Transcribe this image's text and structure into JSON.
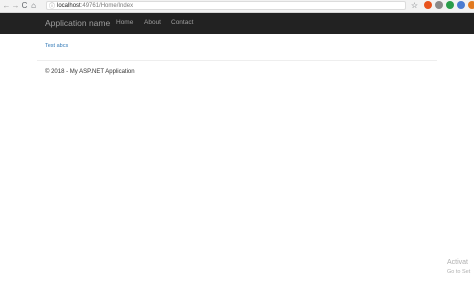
{
  "browser": {
    "back": "←",
    "forward": "→",
    "reload": "C",
    "home": "⌂",
    "url_host": "localhost",
    "url_path": ":49761/Home/Index",
    "star": "☆",
    "extensions": [
      {
        "name": "ext-red",
        "color": "#e8531c"
      },
      {
        "name": "ext-grey",
        "color": "#8a8a8a"
      },
      {
        "name": "ext-green",
        "color": "#2a9d4a"
      },
      {
        "name": "ext-blue",
        "color": "#4a7bd0"
      },
      {
        "name": "ext-orange",
        "color": "#e27a20"
      }
    ]
  },
  "navbar": {
    "brand": "Application name",
    "links": [
      "Home",
      "About",
      "Contact"
    ]
  },
  "main": {
    "link": "Test abcs"
  },
  "footer": {
    "text": "© 2018 - My ASP.NET Application"
  },
  "watermark": {
    "title": "Activat",
    "subtitle": "Go to Set"
  }
}
